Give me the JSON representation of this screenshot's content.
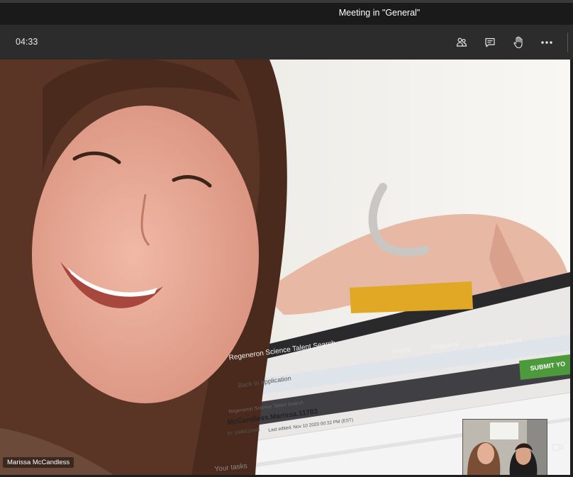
{
  "window": {
    "title": "Meeting in \"General\""
  },
  "meeting": {
    "elapsed": "04:33"
  },
  "toolbar": {
    "participants_icon": "participants-icon",
    "chat_icon": "chat-icon",
    "raise_hand_icon": "raise-hand-icon",
    "more_icon": "more-options-icon"
  },
  "video": {
    "speaker_name": "Marissa McCandless",
    "laptop_screen": {
      "site_title": "Regeneron Science Talent Search",
      "nav_items": [
        "Pages",
        "Programs",
        "My Applications"
      ],
      "submit_label": "SUBMIT YO",
      "back_link": "Back to application",
      "breadcrumb": "Regeneron Science Talent Search",
      "application_name": "McCandless.Marissa.11783",
      "id_label": "ID: 1668815048",
      "last_edited": "Last edited: Nov 10 2020 00:32 PM (EST)",
      "section_heading": "Your tasks"
    }
  },
  "self_view": {
    "camera_switch_icon": "switch-camera-icon"
  },
  "colors": {
    "title_bar": "#1b1a1a",
    "control_bar": "#2d2c2c",
    "submit_green": "#4c9a3c",
    "sticky_note": "#e0a825"
  }
}
